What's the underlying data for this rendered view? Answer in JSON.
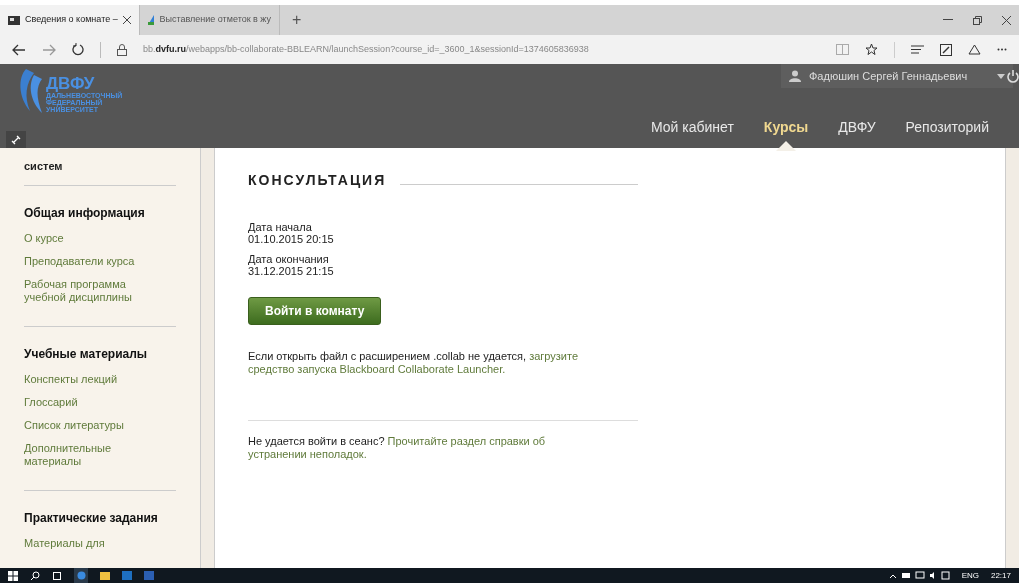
{
  "browser": {
    "tabs": [
      {
        "title": "Сведения о комнате –",
        "selected": true
      },
      {
        "title": "Выставление отметок в жу",
        "selected": false
      }
    ],
    "new_tab": "+",
    "url": "bb.**dvfu.ru**/webapps/bb-collaborate-BBLEARN/launchSession?course_id=_3600_1&sessionId=1374605836938"
  },
  "header": {
    "logo_title": "ДВФУ",
    "logo_subtitle": [
      "ДАЛЬНЕВОСТОЧНЫЙ",
      "ФЕДЕРАЛЬНЫЙ",
      "УНИВЕРСИТЕТ"
    ],
    "user": "Фадюшин Сергей Геннадьевич",
    "nav": [
      {
        "label": "Мой кабинет",
        "selected": false
      },
      {
        "label": "Курсы",
        "selected": true
      },
      {
        "label": "ДВФУ",
        "selected": false
      },
      {
        "label": "Репозиторий",
        "selected": false
      }
    ]
  },
  "sidebar": {
    "sections": [
      {
        "items": [
          "систем"
        ]
      },
      {
        "heading": "Общая информация",
        "items": [
          "О курсе",
          "Преподаватели курса",
          "Рабочая программа учебной дисциплины"
        ]
      },
      {
        "heading": "Учебные материалы",
        "items": [
          "Конспекты лекций",
          "Глоссарий",
          "Список литературы",
          "Дополнительные материалы"
        ]
      },
      {
        "heading": "Практические задания",
        "items": [
          "Материалы для"
        ]
      }
    ]
  },
  "content": {
    "title": "КОНСУЛЬТАЦИЯ",
    "dates": [
      {
        "label": "Дата начала",
        "value": "01.10.2015 20:15"
      },
      {
        "label": "Дата окончания",
        "value": "31.12.2015 21:15"
      }
    ],
    "button": "Войти в комнату",
    "launcher_text": "Если открыть файл с расширением .collab не удается,",
    "launcher_link": [
      "загрузите",
      "средство запуска Blackboard Collaborate Launcher."
    ],
    "help_text": "Не удается войти в сеанс?",
    "help_link": [
      "Прочитайте раздел справки об",
      "устранении неполадок."
    ]
  },
  "taskbar": {
    "language": "ENG",
    "time": "22:17"
  }
}
